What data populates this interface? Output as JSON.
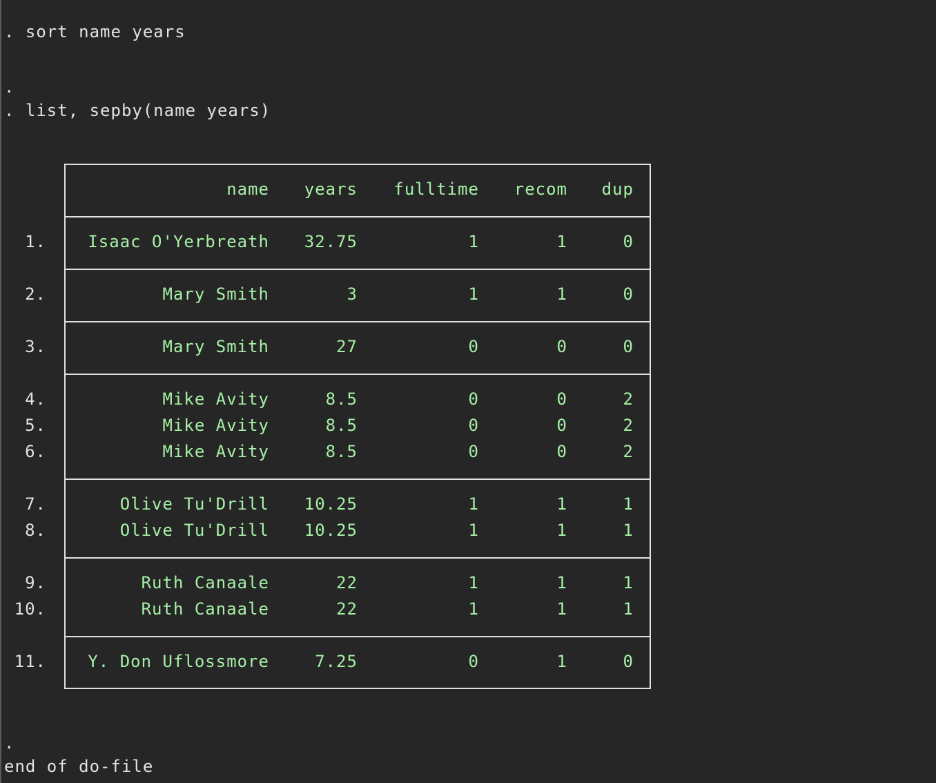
{
  "commands": {
    "sort": ". sort name years",
    "dot1": ".",
    "list": ". list, sepby(name years)",
    "dot2": ".",
    "end": "end of do-file"
  },
  "table": {
    "headers": {
      "name": "name",
      "years": "years",
      "fulltime": "fulltime",
      "recom": "recom",
      "dup": "dup"
    },
    "rows": [
      {
        "obs": "1.",
        "name": "Isaac O'Yerbreath",
        "years": "32.75",
        "fulltime": "1",
        "recom": "1",
        "dup": "0"
      },
      {
        "obs": "2.",
        "name": "Mary Smith",
        "years": "3",
        "fulltime": "1",
        "recom": "1",
        "dup": "0"
      },
      {
        "obs": "3.",
        "name": "Mary Smith",
        "years": "27",
        "fulltime": "0",
        "recom": "0",
        "dup": "0"
      },
      {
        "obs": "4.",
        "name": "Mike Avity",
        "years": "8.5",
        "fulltime": "0",
        "recom": "0",
        "dup": "2"
      },
      {
        "obs": "5.",
        "name": "Mike Avity",
        "years": "8.5",
        "fulltime": "0",
        "recom": "0",
        "dup": "2"
      },
      {
        "obs": "6.",
        "name": "Mike Avity",
        "years": "8.5",
        "fulltime": "0",
        "recom": "0",
        "dup": "2"
      },
      {
        "obs": "7.",
        "name": "Olive Tu'Drill",
        "years": "10.25",
        "fulltime": "1",
        "recom": "1",
        "dup": "1"
      },
      {
        "obs": "8.",
        "name": "Olive Tu'Drill",
        "years": "10.25",
        "fulltime": "1",
        "recom": "1",
        "dup": "1"
      },
      {
        "obs": "9.",
        "name": "Ruth Canaale",
        "years": "22",
        "fulltime": "1",
        "recom": "1",
        "dup": "1"
      },
      {
        "obs": "10.",
        "name": "Ruth Canaale",
        "years": "22",
        "fulltime": "1",
        "recom": "1",
        "dup": "1"
      },
      {
        "obs": "11.",
        "name": "Y. Don Uflossmore",
        "years": "7.25",
        "fulltime": "0",
        "recom": "1",
        "dup": "0"
      }
    ]
  },
  "colors": {
    "background": "#262626",
    "command_text": "#e2e2e2",
    "result_text": "#a6f0a6",
    "table_border": "#e0e0e0"
  }
}
